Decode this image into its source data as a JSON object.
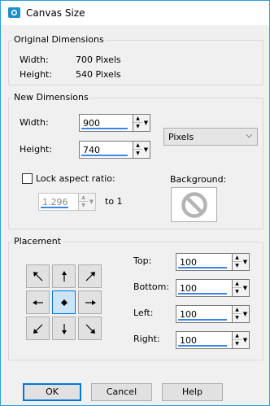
{
  "window": {
    "title": "Canvas Size",
    "icon": "app-icon"
  },
  "original": {
    "legend": "Original Dimensions",
    "width_label": "Width:",
    "width_value": "700 Pixels",
    "height_label": "Height:",
    "height_value": "540 Pixels"
  },
  "new_dims": {
    "legend": "New Dimensions",
    "width_label": "Width:",
    "width_value": "900",
    "height_label": "Height:",
    "height_value": "740",
    "units_value": "Pixels",
    "lock_label": "Lock aspect ratio:",
    "lock_checked": false,
    "ratio_value": "1.296",
    "ratio_suffix": "to 1",
    "background_label": "Background:",
    "background_icon": "no-symbol-icon"
  },
  "placement": {
    "legend": "Placement",
    "grid_icons": [
      "arrow-nw-icon",
      "arrow-up-icon",
      "arrow-ne-icon",
      "arrow-left-icon",
      "center-dot-icon",
      "arrow-right-icon",
      "arrow-sw-icon",
      "arrow-down-icon",
      "arrow-se-icon"
    ],
    "selected": "center",
    "top_label": "Top:",
    "top_value": "100",
    "bottom_label": "Bottom:",
    "bottom_value": "100",
    "left_label": "Left:",
    "left_value": "100",
    "right_label": "Right:",
    "right_value": "100"
  },
  "buttons": {
    "ok": "OK",
    "cancel": "Cancel",
    "help": "Help"
  },
  "colors": {
    "accent": "#0078d7",
    "underline": "#3a86e8",
    "frame": "#2c9fd8"
  }
}
